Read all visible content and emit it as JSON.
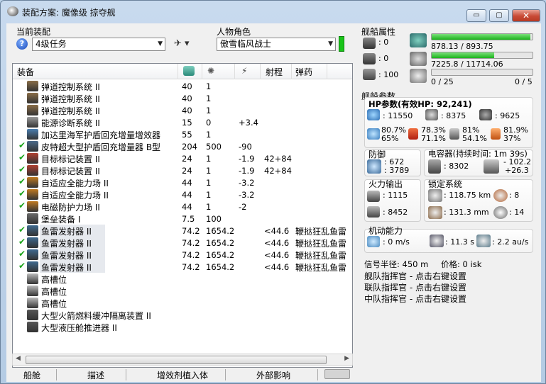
{
  "window": {
    "title": "装配方案: 魔像级 掠夺舰",
    "close": "✕",
    "min": "▭",
    "max": "▢"
  },
  "fitting": {
    "label": "当前装配",
    "selected": "4级任务",
    "character_label": "人物角色",
    "character": "傲雪临风战士"
  },
  "columns": [
    "装备",
    "射程",
    "弹药"
  ],
  "modules": [
    {
      "check": false,
      "name": "弹道控制系统 II",
      "c1": "40",
      "c2": "1",
      "c3": "",
      "c4": "",
      "c5": "",
      "icon": "ballistic-control-icon",
      "color": "#8a6d47"
    },
    {
      "check": false,
      "name": "弹道控制系统 II",
      "c1": "40",
      "c2": "1",
      "c3": "",
      "c4": "",
      "c5": "",
      "icon": "ballistic-control-icon",
      "color": "#8a6d47"
    },
    {
      "check": false,
      "name": "弹道控制系统 II",
      "c1": "40",
      "c2": "1",
      "c3": "",
      "c4": "",
      "c5": "",
      "icon": "ballistic-control-icon",
      "color": "#8a6d47"
    },
    {
      "check": false,
      "name": "能源诊断系统 II",
      "c1": "15",
      "c2": "0",
      "c3": "+3.4",
      "c4": "",
      "c5": "",
      "icon": "power-diagnostic-icon",
      "color": "#9a9a9a"
    },
    {
      "check": false,
      "name": "加达里海军护盾回充增量增效器",
      "c1": "55",
      "c2": "1",
      "c3": "",
      "c4": "",
      "c5": "",
      "icon": "shield-power-relay-icon",
      "color": "#4a7fb0"
    },
    {
      "check": true,
      "name": "皮特超大型护盾回充增量器 B型",
      "c1": "204",
      "c2": "500",
      "c3": "-90",
      "c4": "",
      "c5": "",
      "icon": "shield-booster-icon",
      "color": "#4a6a8a"
    },
    {
      "check": true,
      "name": "目标标记装置 II",
      "c1": "24",
      "c2": "1",
      "c3": "-1.9",
      "c4": "42+84",
      "c5": "",
      "icon": "target-painter-icon",
      "color": "#b04030"
    },
    {
      "check": true,
      "name": "目标标记装置 II",
      "c1": "24",
      "c2": "1",
      "c3": "-1.9",
      "c4": "42+84",
      "c5": "",
      "icon": "target-painter-icon",
      "color": "#b04030"
    },
    {
      "check": true,
      "name": "自适应全能力场 II",
      "c1": "44",
      "c2": "1",
      "c3": "-3.2",
      "c4": "",
      "c5": "",
      "icon": "invulnerability-field-icon",
      "color": "#c07a20"
    },
    {
      "check": true,
      "name": "自适应全能力场 II",
      "c1": "44",
      "c2": "1",
      "c3": "-3.2",
      "c4": "",
      "c5": "",
      "icon": "invulnerability-field-icon",
      "color": "#c07a20"
    },
    {
      "check": true,
      "name": "电磁防护力场 II",
      "c1": "44",
      "c2": "1",
      "c3": "-2",
      "c4": "",
      "c5": "",
      "icon": "em-ward-field-icon",
      "color": "#c07a20"
    },
    {
      "check": false,
      "name": "堡垒装备 I",
      "c1": "7.5",
      "c2": "100",
      "c3": "",
      "c4": "",
      "c5": "",
      "icon": "bastion-module-icon",
      "color": "#6a6a6a"
    },
    {
      "check": true,
      "name": "鱼雷发射器 II",
      "c1": "74.2",
      "c2": "1654.2",
      "c3": "",
      "c4": "<44.6",
      "c5": "鞭挞狂乱鱼雷",
      "icon": "torpedo-launcher-icon",
      "color": "#3f6a8f",
      "hl": true
    },
    {
      "check": true,
      "name": "鱼雷发射器 II",
      "c1": "74.2",
      "c2": "1654.2",
      "c3": "",
      "c4": "<44.6",
      "c5": "鞭挞狂乱鱼雷",
      "icon": "torpedo-launcher-icon",
      "color": "#3f6a8f",
      "hl": true
    },
    {
      "check": true,
      "name": "鱼雷发射器 II",
      "c1": "74.2",
      "c2": "1654.2",
      "c3": "",
      "c4": "<44.6",
      "c5": "鞭挞狂乱鱼雷",
      "icon": "torpedo-launcher-icon",
      "color": "#3f6a8f",
      "hl": true
    },
    {
      "check": true,
      "name": "鱼雷发射器 II",
      "c1": "74.2",
      "c2": "1654.2",
      "c3": "",
      "c4": "<44.6",
      "c5": "鞭挞狂乱鱼雷",
      "icon": "torpedo-launcher-icon",
      "color": "#3f6a8f",
      "hl": true
    },
    {
      "check": false,
      "name": "高槽位",
      "c1": "",
      "c2": "",
      "c3": "",
      "c4": "",
      "c5": "",
      "icon": "empty-high-slot-icon",
      "color": "#bbbbbb"
    },
    {
      "check": false,
      "name": "高槽位",
      "c1": "",
      "c2": "",
      "c3": "",
      "c4": "",
      "c5": "",
      "icon": "empty-high-slot-icon",
      "color": "#bbbbbb"
    },
    {
      "check": false,
      "name": "高槽位",
      "c1": "",
      "c2": "",
      "c3": "",
      "c4": "",
      "c5": "",
      "icon": "empty-high-slot-icon",
      "color": "#bbbbbb"
    },
    {
      "check": false,
      "name": "大型火箭燃料缓冲隔离装置 II",
      "c1": "",
      "c2": "",
      "c3": "",
      "c4": "",
      "c5": "",
      "icon": "rig-icon",
      "color": "#555555"
    },
    {
      "check": false,
      "name": "大型液压舱推进器 II",
      "c1": "",
      "c2": "",
      "c3": "",
      "c4": "",
      "c5": "",
      "icon": "rig-icon",
      "color": "#555555"
    }
  ],
  "tabs": [
    "船舱",
    "描述",
    "增效剂植入体",
    "外部影响"
  ],
  "ship": {
    "attributes_label": "舰船属性",
    "hardpoint1": ": 0",
    "hardpoint2": ": 0",
    "hardpoint3": ": 100",
    "cpu": "878.13 / 893.75",
    "cpu_fraction": 0.982,
    "power": "7225.8 / 11714.06",
    "power_fraction": 0.617,
    "calib_left": "0 / 25",
    "calib_right": "0 / 5",
    "calib_fraction": 0,
    "params_label": "舰船参数",
    "hp_title": "HP参数(有效HP: 92,241)",
    "shield_hp": ": 11550",
    "armor_hp": ": 8375",
    "hull_hp": ": 9625",
    "res_a1": "80.7%",
    "res_a2": "65%",
    "res_b1": "78.3%",
    "res_b2": "71.1%",
    "res_c1": "81%",
    "res_c2": "54.1%",
    "res_d1": "81.9%",
    "res_d2": "37%",
    "defense_label": "防御",
    "def1": ": 672",
    "def2": ": 3789",
    "cap_label": "电容器(持续时间: 1m 39s)",
    "cap1": ": 8302",
    "cap2": "- 102.2",
    "cap3": "+26.3",
    "fire_label": "火力输出",
    "fire1": ": 1115",
    "fire2": ": 8452",
    "lock_label": "锁定系统",
    "lock1": ": 118.75 km",
    "lock2": ": 8",
    "lock3": ": 131.3 mm",
    "lock4": ": 14",
    "nav_label": "机动能力",
    "speed": ": 0 m/s",
    "align": ": 11.3 s",
    "warp": ": 2.2 au/s",
    "sig": "信号半径: 450 m",
    "price": "价格: 0 isk",
    "cmd1": "舰队指挥官 - 点击右键设置",
    "cmd2": "联队指挥官 - 点击右键设置",
    "cmd3": "中队指挥官 - 点击右键设置"
  }
}
